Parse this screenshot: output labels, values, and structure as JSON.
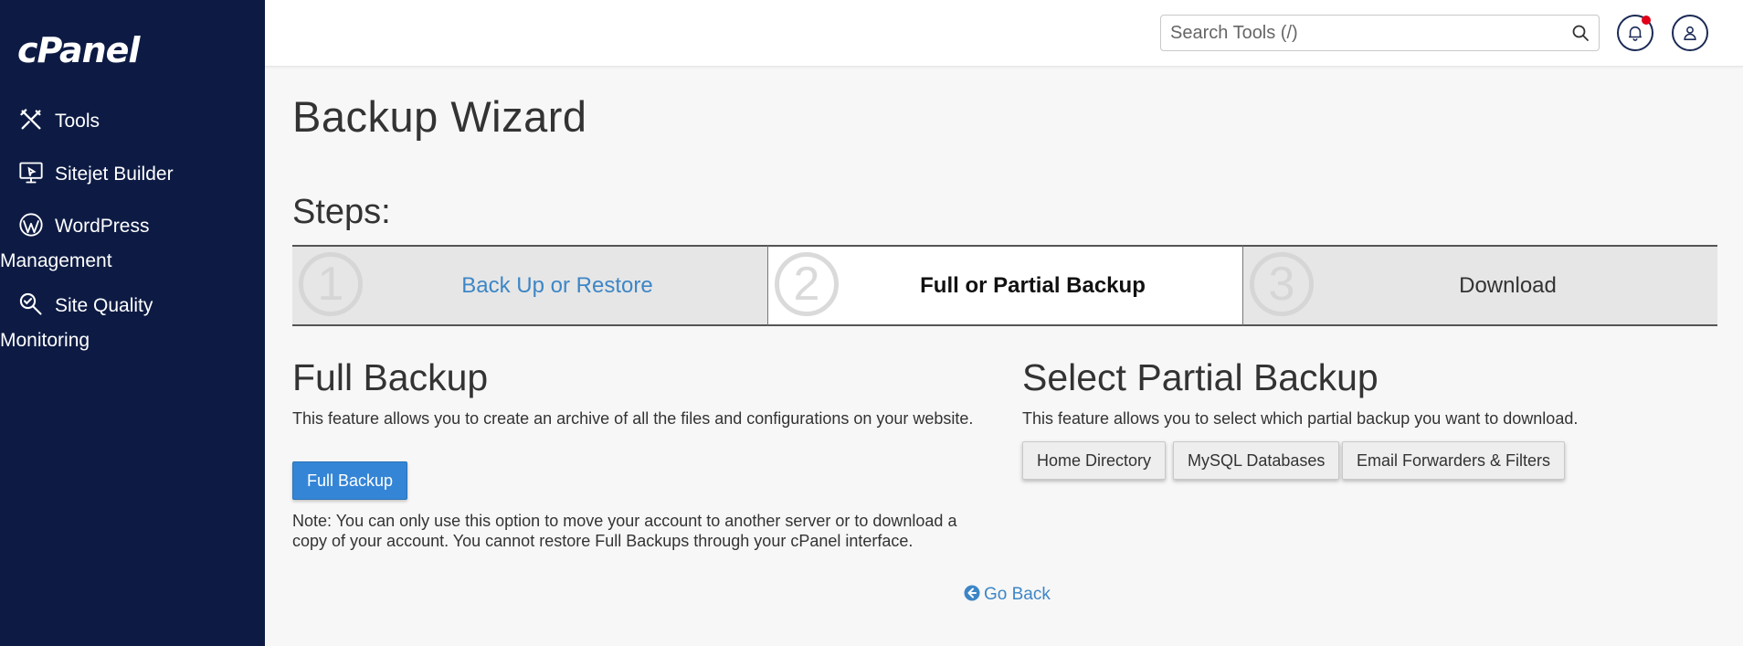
{
  "app": {
    "logo_text": "cPanel"
  },
  "sidebar": {
    "items": [
      {
        "label": "Tools",
        "icon": "tools-icon"
      },
      {
        "label": "Sitejet Builder",
        "icon": "monitor-icon"
      },
      {
        "label": "WordPress",
        "label2": "Management",
        "icon": "wordpress-icon"
      },
      {
        "label": "Site Quality",
        "label2": "Monitoring",
        "icon": "magnifier-icon"
      }
    ]
  },
  "topbar": {
    "search_placeholder": "Search Tools (/)",
    "search_icon": "search-icon",
    "notifications_icon": "bell-icon",
    "user_icon": "user-icon",
    "notification_dot_color": "#e1001a"
  },
  "page": {
    "title": "Backup Wizard",
    "steps_title": "Steps:",
    "steps": [
      {
        "number": "1",
        "label": "Back Up or Restore",
        "state": "link"
      },
      {
        "number": "2",
        "label": "Full or Partial Backup",
        "state": "active"
      },
      {
        "number": "3",
        "label": "Download",
        "state": "inactive"
      }
    ]
  },
  "full_backup": {
    "title": "Full Backup",
    "description": "This feature allows you to create an archive of all the files and configurations on your website.",
    "button_label": "Full Backup",
    "note": "Note: You can only use this option to move your account to another server or to download a copy of your account. You cannot restore Full Backups through your cPanel interface."
  },
  "partial_backup": {
    "title": "Select Partial Backup",
    "description": "This feature allows you to select which partial backup you want to download.",
    "buttons": [
      "Home Directory",
      "MySQL Databases",
      "Email Forwarders & Filters"
    ]
  },
  "go_back": {
    "label": "Go Back",
    "icon": "arrow-circle-left-icon"
  },
  "colors": {
    "sidebar_bg": "#0d1b44",
    "primary_button": "#3485d6",
    "link": "#3d86c6",
    "page_bg": "#f7f7f7"
  }
}
